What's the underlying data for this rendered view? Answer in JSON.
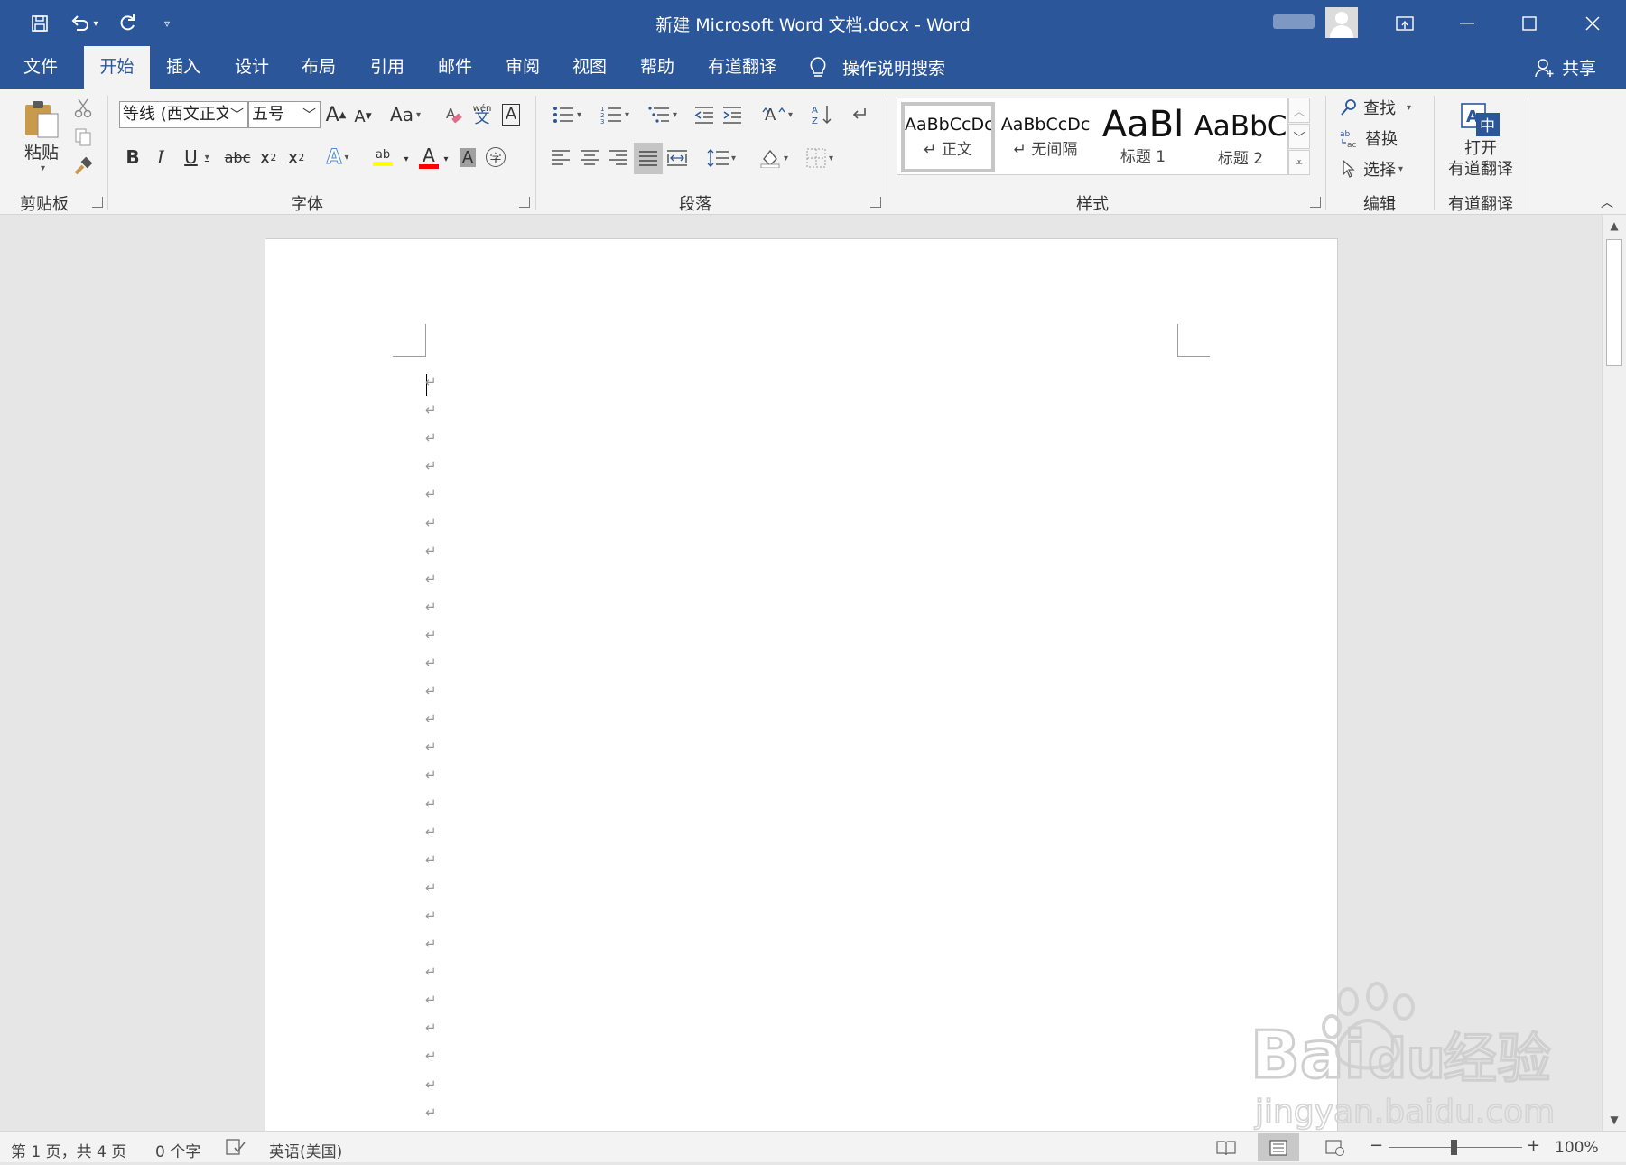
{
  "window": {
    "title": "新建 Microsoft Word 文档.docx  -  Word"
  },
  "quick_access": {
    "icons": [
      "save-icon",
      "undo-icon",
      "redo-icon",
      "customize-icon"
    ]
  },
  "tabs": [
    {
      "label": "文件",
      "active": false
    },
    {
      "label": "开始",
      "active": true
    },
    {
      "label": "插入",
      "active": false
    },
    {
      "label": "设计",
      "active": false
    },
    {
      "label": "布局",
      "active": false
    },
    {
      "label": "引用",
      "active": false
    },
    {
      "label": "邮件",
      "active": false
    },
    {
      "label": "审阅",
      "active": false
    },
    {
      "label": "视图",
      "active": false
    },
    {
      "label": "帮助",
      "active": false
    },
    {
      "label": "有道翻译",
      "active": false
    }
  ],
  "tell_me": "操作说明搜索",
  "share": "共享",
  "ribbon": {
    "clipboard": {
      "label": "剪贴板",
      "paste": "粘贴"
    },
    "font": {
      "label": "字体",
      "font_name": "等线 (西文正文",
      "font_size": "五号"
    },
    "paragraph": {
      "label": "段落"
    },
    "styles": {
      "label": "样式",
      "items": [
        {
          "sample": "AaBbCcDc",
          "name": "↵ 正文"
        },
        {
          "sample": "AaBbCcDc",
          "name": "↵ 无间隔"
        },
        {
          "sample": "AaBl",
          "name": "标题 1"
        },
        {
          "sample": "AaBbC",
          "name": "标题 2"
        }
      ]
    },
    "editing": {
      "label": "编辑",
      "find": "查找",
      "replace": "替换",
      "select": "选择"
    },
    "youdao": {
      "label": "有道翻译",
      "open_line1": "打开",
      "open_line2": "有道翻译"
    }
  },
  "document": {
    "paragraph_mark": "↵",
    "paragraph_count": 27
  },
  "status": {
    "page": "第 1 页，共 4 页",
    "words": "0 个字",
    "language": "英语(美国)",
    "zoom": "100%",
    "zoom_minus": "−",
    "zoom_plus": "+"
  },
  "colors": {
    "brand": "#2b579a",
    "highlight": "#ffff00",
    "font_color": "#ff0000"
  },
  "watermark": {
    "brand": "Bai du 经验",
    "url": "jingyan.baidu.com"
  }
}
